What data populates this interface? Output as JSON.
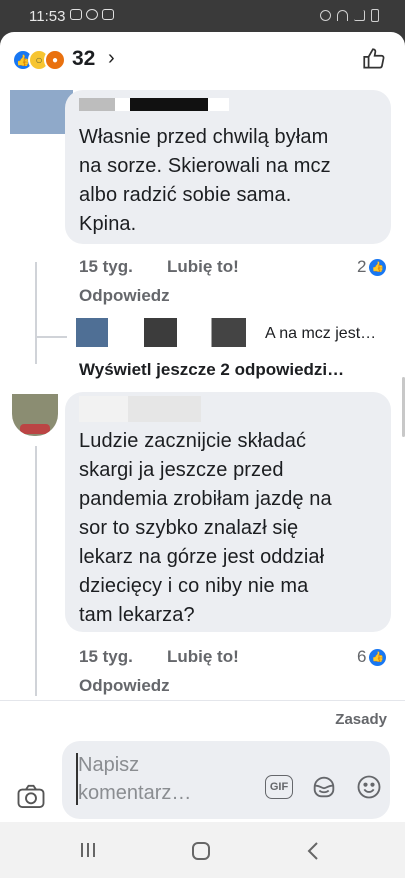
{
  "status_bar": {
    "time": "11:53"
  },
  "reactions": {
    "count": "32",
    "chevron": "›"
  },
  "comments": [
    {
      "text_lines": [
        "Własnie przed chwilą byłam",
        "na sorze. Skierowali na mcz",
        "albo radzić sobie sama.",
        "Kpina."
      ],
      "time": "15 tyg.",
      "like_label": "Lubię to!",
      "reply_label": "Odpowiedz",
      "like_count": "2"
    },
    {
      "text_lines": [
        "Ludzie zacznijcie składać",
        "skargi ja jeszcze przed",
        "pandemia zrobiłam jazdę na",
        "sor to szybko znalazł się",
        "lekarz na górze jest oddział",
        "dziecięcy i co niby nie ma",
        "tam lekarza?"
      ],
      "time": "15 tyg.",
      "like_label": "Lubię to!",
      "reply_label": "Odpowiedz",
      "like_count": "6"
    }
  ],
  "reply_preview": {
    "text": "A na mcz jest…"
  },
  "more_replies": {
    "label": "Wyświetl jeszcze 2 odpowiedzi…"
  },
  "footer": {
    "rules": "Zasady"
  },
  "composer": {
    "placeholder_line1": "Napisz",
    "placeholder_line2": "komentarz…",
    "gif": "GIF"
  },
  "colors": {
    "accent": "#1877f2",
    "bubble": "#eceef2",
    "meta": "#65676b"
  }
}
